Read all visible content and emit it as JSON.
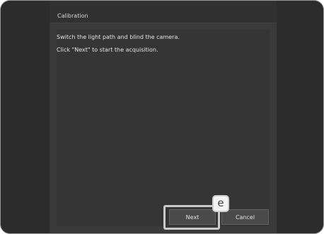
{
  "window": {
    "title": "Calibration"
  },
  "instructions": {
    "line1": "Switch the light path and blind the camera.",
    "line2": "Click \"Next\" to start the acquisition."
  },
  "buttons": {
    "next_label": "Next",
    "cancel_label": "Cancel"
  },
  "annotation": {
    "callout_label": "e",
    "highlight_color": "#c9c9c9"
  },
  "colors": {
    "background": "#3a3a3a",
    "side_panels": "#2c2c2c",
    "text": "#e4e4e4"
  }
}
